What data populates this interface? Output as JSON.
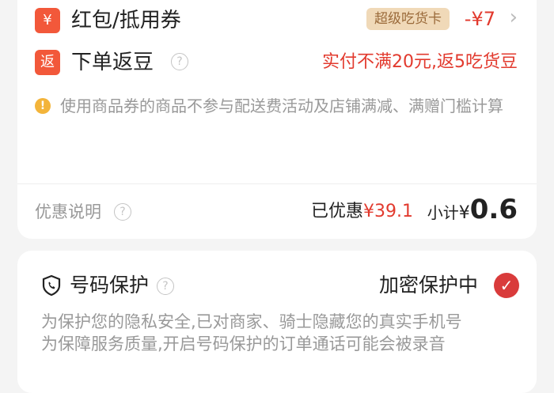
{
  "discounts": {
    "redpacket": {
      "badge": "¥",
      "label": "红包/抵用券",
      "vip_tag": "超级吃货卡",
      "amount": "-¥7",
      "chevron": "›"
    },
    "cashback": {
      "badge": "返",
      "label": "下单返豆",
      "help": "?",
      "note": "实付不满20元,返5吃货豆"
    },
    "info": {
      "icon": "!",
      "text": "使用商品券的商品不参与配送费活动及店铺满减、满赠门槛计算"
    }
  },
  "summary": {
    "label": "优惠说明",
    "help": "?",
    "saved_label": "已优惠",
    "saved_amount": "¥39.1",
    "subtotal_label": "小计",
    "currency": "¥",
    "subtotal_value": "0.6"
  },
  "privacy": {
    "title": "号码保护",
    "help": "?",
    "status": "加密保护中",
    "check": "✓",
    "desc_line1": "为保护您的隐私安全,已对商家、骑士隐藏您的真实手机号",
    "desc_line2": "为保障服务质量,开启号码保护的订单通话可能会被录音"
  },
  "colors": {
    "accent_red": "#e23a2e",
    "badge_orange": "#f2583a",
    "info_yellow": "#f3b43a",
    "check_red": "#d93b3b"
  }
}
